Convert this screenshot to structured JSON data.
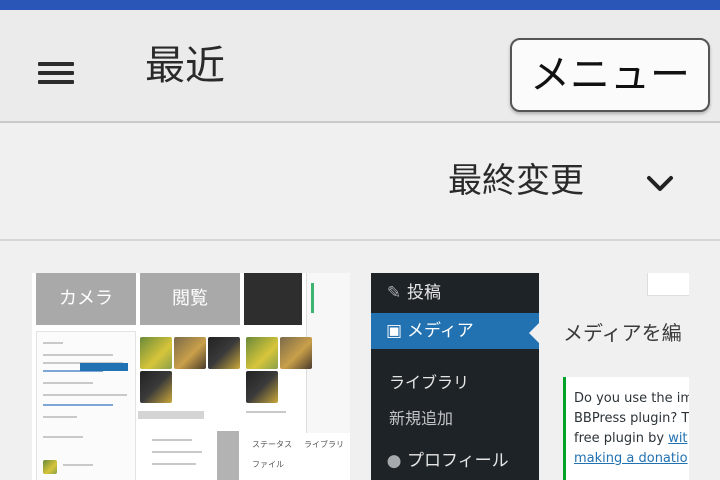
{
  "appbar": {
    "title": "最近",
    "menu_label": "メニュー",
    "hamburger_icon": "hamburger-icon"
  },
  "sortbar": {
    "label": "最終変更",
    "chevron_icon": "chevron-down-icon"
  },
  "thumb1": {
    "btn_camera": "カメラ",
    "btn_browse": "閲覧",
    "small_1": "ステータス",
    "small_2": "ライブラリ",
    "small_3": "ファイル"
  },
  "thumb2": {
    "sidebar": {
      "post": "投稿",
      "media": "メディア",
      "library": "ライブラリ",
      "add_new": "新規追加",
      "profile": "プロフィール"
    },
    "heading": "メディアを編",
    "notice": {
      "line1": "Do you use the im",
      "line2": "BBPress plugin? T",
      "line3_prefix": "free plugin by ",
      "line3_link": "wit",
      "line4_link": "making a donatio"
    }
  },
  "colors": {
    "status_bar": "#2a56b8",
    "wp_sidebar": "#1d2327",
    "wp_accent": "#2271b1",
    "notice_green": "#00a32a"
  }
}
